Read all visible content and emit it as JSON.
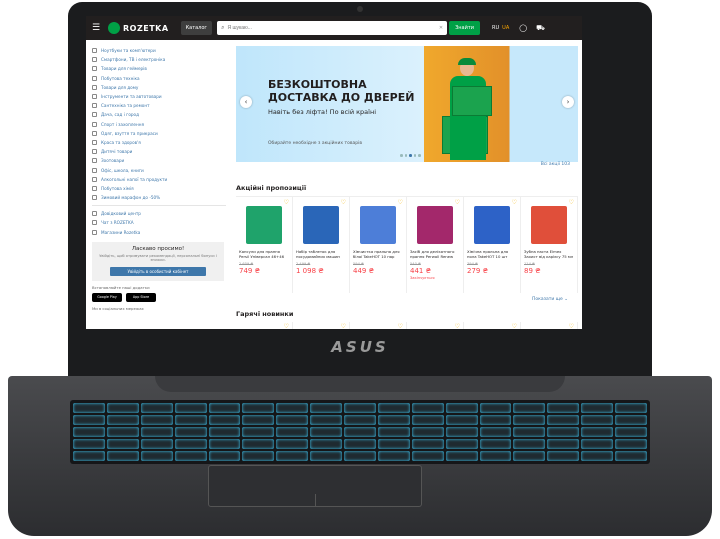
{
  "header": {
    "brand": "ROZETKA",
    "catalog_label": "Каталог",
    "search_placeholder": "Я шукаю...",
    "search_button": "Знайти",
    "lang_active": "RU",
    "lang_other": "UA"
  },
  "sidebar": {
    "items": [
      "Ноутбуки та комп'ютери",
      "Смартфони, ТВ і електроніка",
      "Товари для геймерів",
      "Побутова техніка",
      "Товари для дому",
      "Інструменти та автотовари",
      "Сантехніка та ремонт",
      "Дача, сад і город",
      "Спорт і захоплення",
      "Одяг, взуття та прикраси",
      "Краса та здоров'я",
      "Дитячі товари",
      "Зоотовари",
      "Офіс, школа, книги",
      "Алкогольні напої та продукти",
      "Побутова хімія",
      "Зимовий марафон до -50%"
    ],
    "extra_items": [
      "Довідковий центр",
      "Чат з ROZETKA",
      "Магазини Rozetka"
    ],
    "login_title": "Ласкаво просимо!",
    "login_desc": "Увійдіть, щоб отримувати рекомендації, персональні бонуси і знижки.",
    "login_button": "Увійдіть в особистий кабінет",
    "apps_title": "Встановлюйте наші додатки",
    "apps": [
      "Google Play",
      "App Store"
    ],
    "social_title": "Ми в соціальних мережах"
  },
  "banner": {
    "headline_1": "БЕЗКОШТОВНА",
    "headline_2": "ДОСТАВКА ДО ДВЕРЕЙ",
    "subline": "Навіть без ліфта! По всій країні",
    "footnote": "Обирайте необхідне з акційних товарів",
    "all_link": "Всі акції  103"
  },
  "promo": {
    "title": "Акційні пропозиції",
    "more_link": "Показати ще  ⌄",
    "products": [
      {
        "name": "Капсули для прання Persil Універсал 46+46",
        "old": "2 659 ₴",
        "price": "749 ₴",
        "tag": "",
        "color": "#1fa36b"
      },
      {
        "name": "Набір таблеток для посудомийних машин",
        "old": "2 499 ₴",
        "price": "1 098 ₴",
        "tag": "",
        "color": "#2a66b8"
      },
      {
        "name": "Хімчистка пральна для білої TakeHOT 10 пар",
        "old": "594 ₴",
        "price": "449 ₴",
        "tag": "",
        "color": "#4d7ed8"
      },
      {
        "name": "Засіб для делікатного прання Perwoll Renew",
        "old": "540 ₴",
        "price": "441 ₴",
        "tag": "Закінчується",
        "color": "#a3286b"
      },
      {
        "name": "Хімічна пральна для пола TakeHOT 10 шт",
        "old": "394 ₴",
        "price": "279 ₴",
        "tag": "",
        "color": "#2d62c7"
      },
      {
        "name": "Зубна паста Elmex Захист від карієсу 75 мл",
        "old": "114 ₴",
        "price": "89 ₴",
        "tag": "",
        "color": "#e04f3a"
      }
    ]
  },
  "hot": {
    "title": "Гарячі новинки"
  },
  "device": {
    "brand": "ASUS"
  }
}
